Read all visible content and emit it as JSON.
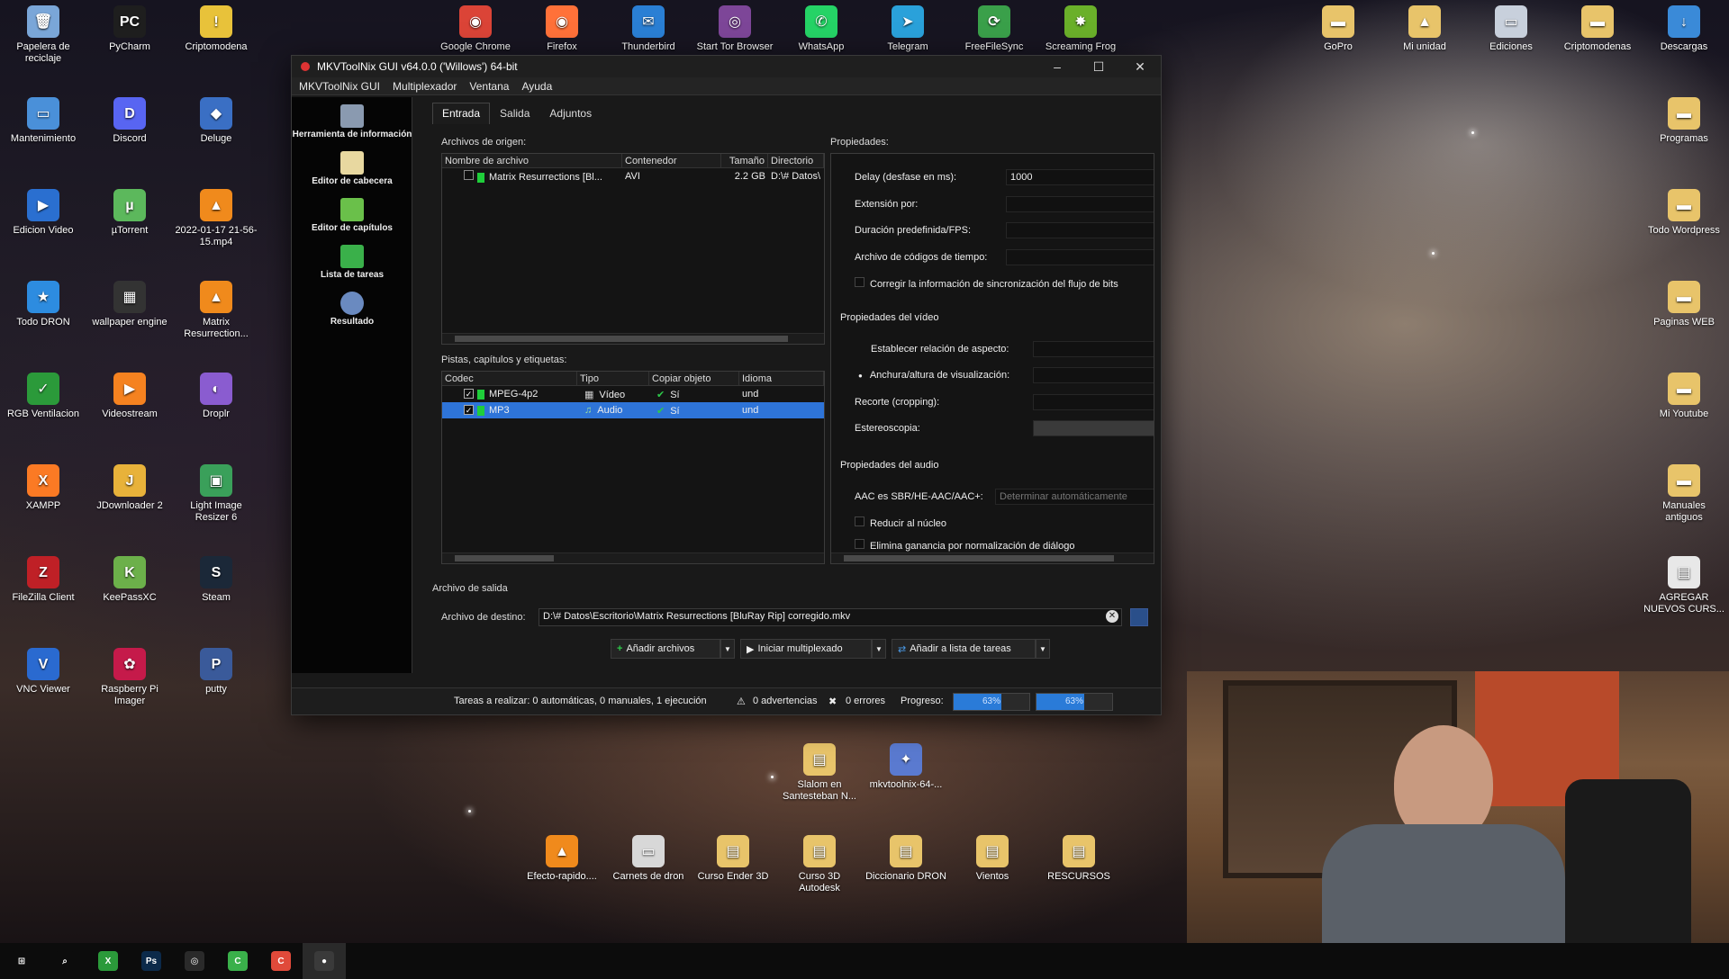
{
  "desktop_left": [
    {
      "id": "papelera",
      "label": "Papelera de reciclaje",
      "color": "#7aa6d8",
      "glyph": "🗑"
    },
    {
      "id": "pycharm",
      "label": "PyCharm",
      "color": "#1e1e1e",
      "glyph": "PC"
    },
    {
      "id": "criptomodena",
      "label": "Criptomodena",
      "color": "#e8c23a",
      "glyph": "!"
    },
    {
      "id": "mantenimiento",
      "label": "Mantenimiento",
      "color": "#4a90d9",
      "glyph": "▭"
    },
    {
      "id": "discord",
      "label": "Discord",
      "color": "#5865f2",
      "glyph": "D"
    },
    {
      "id": "deluge",
      "label": "Deluge",
      "color": "#3a6fc4",
      "glyph": "◆"
    },
    {
      "id": "edicion-video",
      "label": "Edicion Video",
      "color": "#2a6fd0",
      "glyph": "▶"
    },
    {
      "id": "utorrent",
      "label": "µTorrent",
      "color": "#5cb85c",
      "glyph": "µ"
    },
    {
      "id": "video-file",
      "label": "2022-01-17 21-56-15.mp4",
      "color": "#f08a1c",
      "glyph": "▲"
    },
    {
      "id": "todo-dron",
      "label": "Todo DRON",
      "color": "#2d8ce0",
      "glyph": "★"
    },
    {
      "id": "wallpaper-engine",
      "label": "wallpaper engine",
      "color": "#333",
      "glyph": "▦"
    },
    {
      "id": "matrix",
      "label": "Matrix Resurrection...",
      "color": "#f08a1c",
      "glyph": "▲"
    },
    {
      "id": "rgb-ventilacion",
      "label": "RGB Ventilacion",
      "color": "#2b9a3a",
      "glyph": "✓"
    },
    {
      "id": "videostream",
      "label": "Videostream",
      "color": "#f58220",
      "glyph": "▶"
    },
    {
      "id": "droplr",
      "label": "Droplr",
      "color": "#8a5cd0",
      "glyph": "◐"
    },
    {
      "id": "xampp",
      "label": "XAMPP",
      "color": "#fb7a24",
      "glyph": "X"
    },
    {
      "id": "jdownloader",
      "label": "JDownloader 2",
      "color": "#e8b23a",
      "glyph": "J"
    },
    {
      "id": "light-image-resizer",
      "label": "Light Image Resizer 6",
      "color": "#3aa05a",
      "glyph": "▣"
    },
    {
      "id": "filezilla",
      "label": "FileZilla Client",
      "color": "#bf2026",
      "glyph": "Z"
    },
    {
      "id": "keepassxc",
      "label": "KeePassXC",
      "color": "#6cb04a",
      "glyph": "K"
    },
    {
      "id": "steam",
      "label": "Steam",
      "color": "#1b2838",
      "glyph": "S"
    },
    {
      "id": "vnc-viewer",
      "label": "VNC Viewer",
      "color": "#2a6ad0",
      "glyph": "V"
    },
    {
      "id": "raspberry-pi-imager",
      "label": "Raspberry Pi Imager",
      "color": "#c51a4a",
      "glyph": "✿"
    },
    {
      "id": "putty",
      "label": "putty",
      "color": "#3a5a9a",
      "glyph": "P"
    }
  ],
  "desktop_top": [
    {
      "id": "google-chrome",
      "label": "Google Chrome",
      "color": "#db4437",
      "glyph": "◉"
    },
    {
      "id": "firefox",
      "label": "Firefox",
      "color": "#ff7139",
      "glyph": "◉"
    },
    {
      "id": "thunderbird",
      "label": "Thunderbird",
      "color": "#2a7fd4",
      "glyph": "✉"
    },
    {
      "id": "tor-browser",
      "label": "Start Tor Browser",
      "color": "#7d4698",
      "glyph": "◎"
    },
    {
      "id": "whatsapp",
      "label": "WhatsApp",
      "color": "#25d366",
      "glyph": "✆"
    },
    {
      "id": "telegram",
      "label": "Telegram",
      "color": "#2aa1da",
      "glyph": "➤"
    },
    {
      "id": "freefilesync",
      "label": "FreeFileSync",
      "color": "#3aa04a",
      "glyph": "⟳"
    },
    {
      "id": "screaming-frog",
      "label": "Screaming Frog",
      "color": "#6ab02a",
      "glyph": "✸"
    }
  ],
  "desktop_right": [
    {
      "id": "gopro",
      "label": "GoPro",
      "color": "#e8c46a",
      "glyph": "▬"
    },
    {
      "id": "mi-unidad",
      "label": "Mi unidad",
      "color": "#e8c46a",
      "glyph": "▲"
    },
    {
      "id": "ediciones",
      "label": "Ediciones",
      "color": "#c8d0dc",
      "glyph": "▭"
    },
    {
      "id": "criptomodenas",
      "label": "Criptomodenas",
      "color": "#e8c46a",
      "glyph": "▬"
    },
    {
      "id": "descargas",
      "label": "Descargas",
      "color": "#3a8ad8",
      "glyph": "↓"
    },
    {
      "id": "programas",
      "label": "Programas",
      "color": "#e8c46a",
      "glyph": "▬"
    },
    {
      "id": "todo-wordpress",
      "label": "Todo Wordpress",
      "color": "#e8c46a",
      "glyph": "▬"
    },
    {
      "id": "paginas-web",
      "label": "Paginas WEB",
      "color": "#e8c46a",
      "glyph": "▬"
    },
    {
      "id": "mi-youtube",
      "label": "Mi Youtube",
      "color": "#e8c46a",
      "glyph": "▬"
    },
    {
      "id": "manuales-antiguos",
      "label": "Manuales antiguos",
      "color": "#e8c46a",
      "glyph": "▬"
    },
    {
      "id": "agregar-nuevos-cursos",
      "label": "AGREGAR NUEVOS CURS...",
      "color": "#e8e8e8",
      "glyph": "▤"
    }
  ],
  "desktop_bottom": [
    {
      "id": "slalom",
      "label": "Slalom en Santesteban N...",
      "color": "#e8c46a",
      "glyph": "▤"
    },
    {
      "id": "mkvtoolnix-setup",
      "label": "mkvtoolnix-64-...",
      "color": "#5a7ad0",
      "glyph": "✦"
    },
    {
      "id": "efecto-rapido",
      "label": "Efecto-rapido....",
      "color": "#f08a1c",
      "glyph": "▲"
    },
    {
      "id": "carnets-dron",
      "label": "Carnets de dron",
      "color": "#d8d8d8",
      "glyph": "▭"
    },
    {
      "id": "curso-ender",
      "label": "Curso Ender 3D",
      "color": "#e8c46a",
      "glyph": "▤"
    },
    {
      "id": "curso-3d-autodesk",
      "label": "Curso 3D Autodesk",
      "color": "#e8c46a",
      "glyph": "▤"
    },
    {
      "id": "diccionario-dron",
      "label": "Diccionario DRON",
      "color": "#e8c46a",
      "glyph": "▤"
    },
    {
      "id": "vientos",
      "label": "Vientos",
      "color": "#e8c46a",
      "glyph": "▤"
    },
    {
      "id": "recursos",
      "label": "RESCURSOS",
      "color": "#e8c46a",
      "glyph": "▤"
    }
  ],
  "window": {
    "title": "MKVToolNix GUI v64.0.0 ('Willows') 64-bit",
    "menu": [
      "MKVToolNix GUI",
      "Multiplexador",
      "Ventana",
      "Ayuda"
    ],
    "sidebar": [
      {
        "label": "Herramienta de información",
        "color": "#8a9ab0"
      },
      {
        "label": "Editor de cabecera",
        "color": "#e8d8a0"
      },
      {
        "label": "Editor de capítulos",
        "color": "#6ac04a"
      },
      {
        "label": "Lista de tareas",
        "color": "#3ab04a"
      },
      {
        "label": "Resultado",
        "color": "#6a8ac0"
      }
    ],
    "tabs": [
      "Entrada",
      "Salida",
      "Adjuntos"
    ],
    "source_files_label": "Archivos de origen:",
    "files_headers": [
      "Nombre de archivo",
      "Contenedor",
      "Tamaño",
      "Directorio"
    ],
    "files": [
      {
        "name": "Matrix Resurrections [Bl...",
        "container": "AVI",
        "size": "2.2 GB",
        "dir": "D:\\# Datos\\"
      }
    ],
    "tracks_label": "Pistas, capítulos y etiquetas:",
    "tracks_headers": [
      "Codec",
      "Tipo",
      "Copiar objeto",
      "Idioma"
    ],
    "tracks": [
      {
        "codec": "MPEG-4p2",
        "type": "Vídeo",
        "copy": "Sí",
        "lang": "und",
        "checked": "✓"
      },
      {
        "codec": "MP3",
        "type": "Audio",
        "copy": "Sí",
        "lang": "und",
        "checked": "✓"
      }
    ],
    "properties_label": "Propiedades:",
    "props": {
      "delay_label": "Delay (desfase en ms):",
      "delay_value": "1000",
      "stretch_label": "Extensión por:",
      "fps_label": "Duración predefinida/FPS:",
      "timecodes_label": "Archivo de códigos de tiempo:",
      "fix_sync_label": "Corregir la información de sincronización del flujo de bits",
      "video_group": "Propiedades del vídeo",
      "aspect_label": "Establecer relación de aspecto:",
      "display_dims_label": "Anchura/altura de visualización:",
      "crop_label": "Recorte (cropping):",
      "stereo_label": "Estereoscopia:",
      "audio_group": "Propiedades del audio",
      "aac_label": "AAC es SBR/HE-AAC/AAC+:",
      "aac_value": "Determinar automáticamente",
      "reduce_label": "Reducir al núcleo",
      "dialog_norm_label": "Elimina ganancia por normalización de diálogo"
    },
    "output_section": "Archivo de salida",
    "dest_label": "Archivo de destino:",
    "dest_value": "D:\\# Datos\\Escritorio\\Matrix Resurrections [BluRay Rip] corregido.mkv",
    "buttons": {
      "add_files": "Añadir archivos",
      "start_mux": "Iniciar multiplexado",
      "add_to_queue": "Añadir a lista de tareas"
    },
    "status": {
      "tasks": "Tareas a realizar:  0 automáticas, 0 manuales, 1 ejecución",
      "warnings": "0 advertencias",
      "errors": "0 errores",
      "progress_label": "Progreso:",
      "progress1": "63%",
      "progress2": "63%",
      "progress_fraction": 0.63
    }
  },
  "taskbar": [
    {
      "id": "start",
      "glyph": "⊞",
      "color": "#0c0c0c"
    },
    {
      "id": "search",
      "glyph": "⌕",
      "color": "#0c0c0c"
    },
    {
      "id": "xbox",
      "glyph": "X",
      "color": "#2b9a3a"
    },
    {
      "id": "photoshop",
      "glyph": "Ps",
      "color": "#0c2a4a"
    },
    {
      "id": "obs",
      "glyph": "◎",
      "color": "#2a2a2a"
    },
    {
      "id": "camtasia-green",
      "glyph": "C",
      "color": "#3ab04a"
    },
    {
      "id": "camtasia-red",
      "glyph": "C",
      "color": "#e04a3a"
    },
    {
      "id": "mkvtoolnix",
      "glyph": "●",
      "color": "#3a3a3a"
    }
  ]
}
